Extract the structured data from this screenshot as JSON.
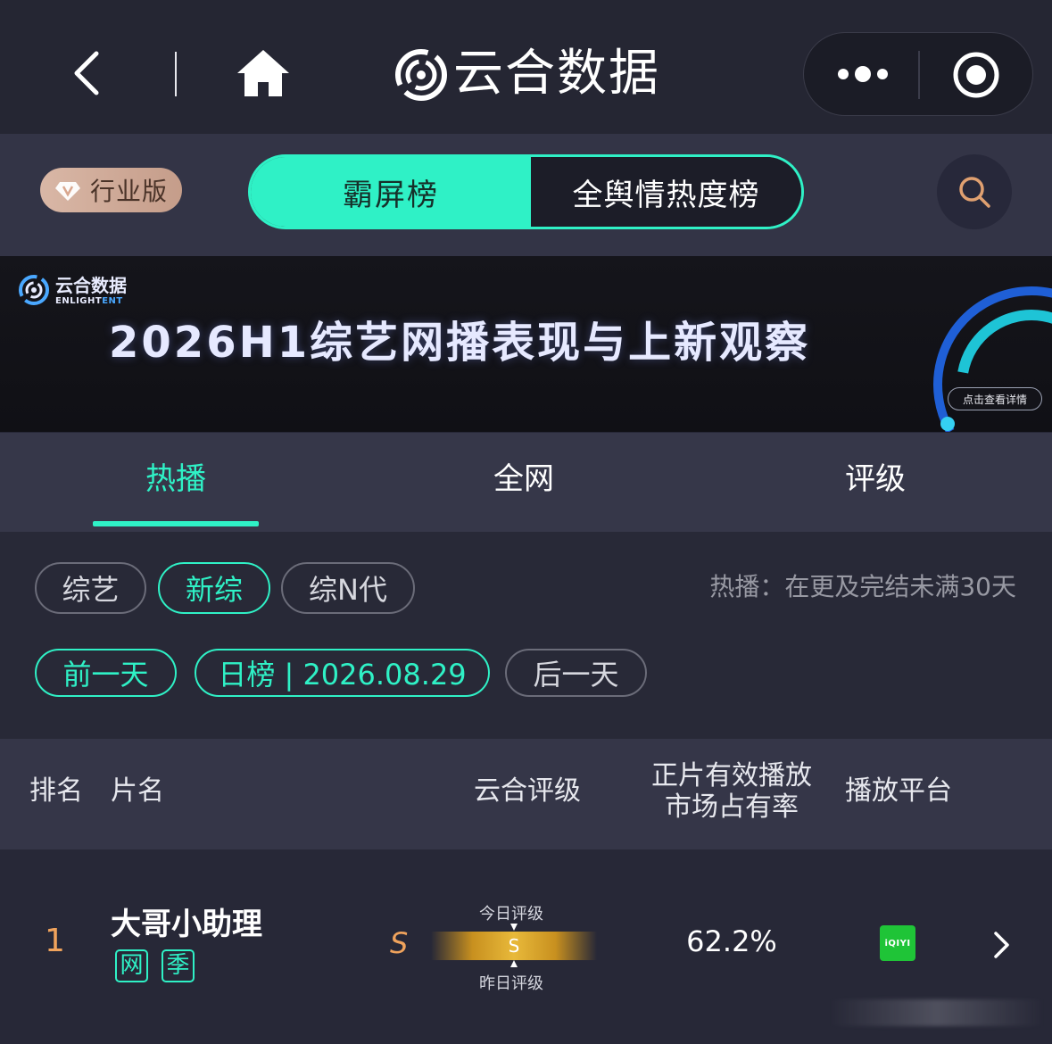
{
  "nav": {
    "title": "云合数据",
    "back_icon": "chevron-left-icon",
    "home_icon": "home-icon",
    "more_icon": "more-dots-icon",
    "target_icon": "target-icon"
  },
  "toprow": {
    "pro_label": "行业版",
    "toggle_active": "霸屏榜",
    "toggle_inactive": "全舆情热度榜",
    "search_icon": "search-icon",
    "accent": "#2ff1c6"
  },
  "banner": {
    "brand": "云合数据",
    "brand_sub_a": "ENLIGHT",
    "brand_sub_b": "ENT",
    "title": "2026H1综艺网播表现与上新观察",
    "cta": "点击查看详情"
  },
  "tabs": [
    {
      "label": "热播",
      "active": true
    },
    {
      "label": "全网",
      "active": false
    },
    {
      "label": "评级",
      "active": false
    }
  ],
  "filters": {
    "categories": [
      "综艺",
      "新综",
      "综N代"
    ],
    "active_category": "新综",
    "note": "热播：在更及完结未满30天",
    "prev_day": "前一天",
    "date_label": "日榜 | 2026.08.29",
    "next_day": "后一天"
  },
  "table": {
    "headers": {
      "rank": "排名",
      "name": "片名",
      "rating": "云合评级",
      "share_line1": "正片有效播放",
      "share_line2": "市场占有率",
      "platform": "播放平台"
    },
    "rows": [
      {
        "rank": "1",
        "title": "大哥小助理",
        "tags": [
          "网",
          "季"
        ],
        "grade": "S",
        "grade_bar_letter": "S",
        "today_label": "今日评级",
        "yesterday_label": "昨日评级",
        "share": "62.2%",
        "platform": "iQIYI"
      }
    ]
  }
}
